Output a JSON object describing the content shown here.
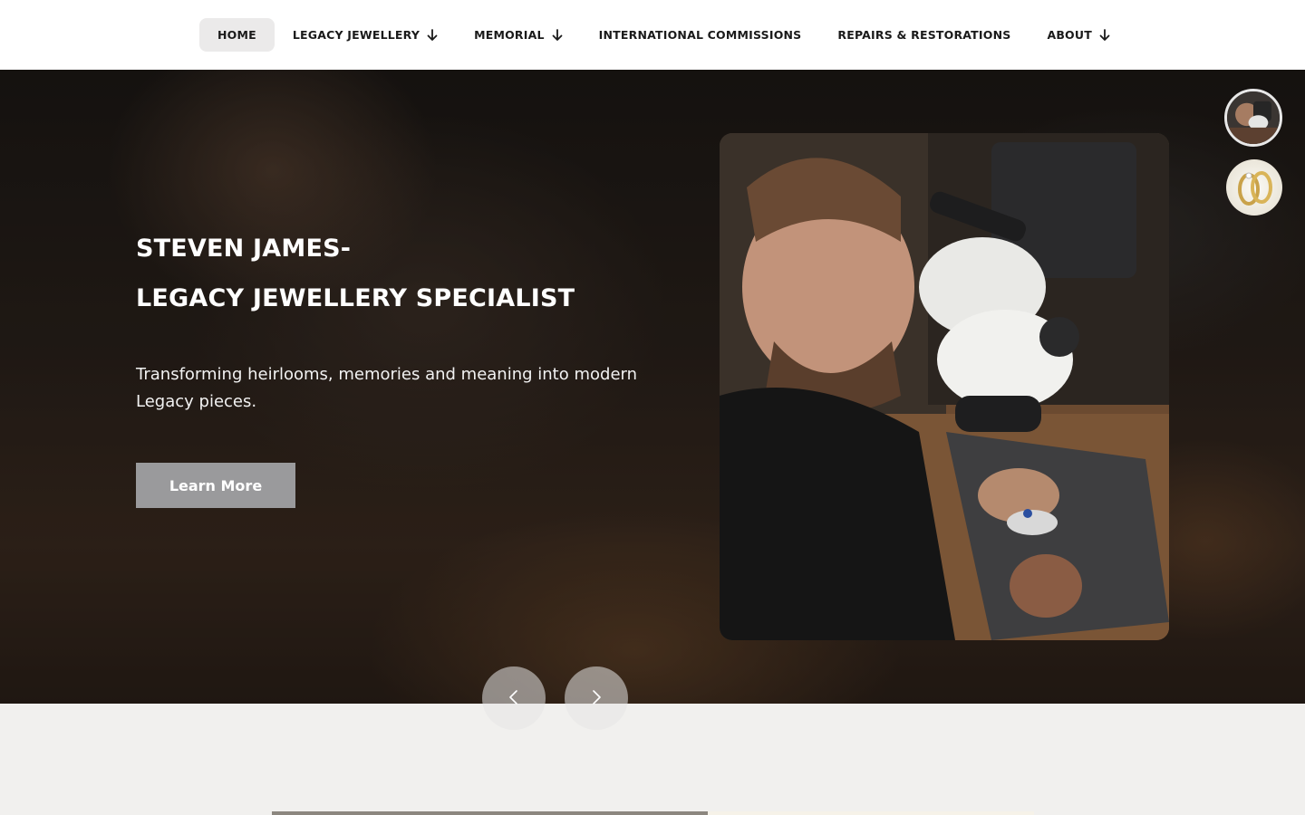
{
  "nav": {
    "items": [
      {
        "label": "HOME",
        "active": true,
        "dropdown": false
      },
      {
        "label": "LEGACY JEWELLERY",
        "active": false,
        "dropdown": true
      },
      {
        "label": "MEMORIAL",
        "active": false,
        "dropdown": true
      },
      {
        "label": "INTERNATIONAL COMMISSIONS",
        "active": false,
        "dropdown": false
      },
      {
        "label": "REPAIRS & RESTORATIONS",
        "active": false,
        "dropdown": false
      },
      {
        "label": "ABOUT",
        "active": false,
        "dropdown": true
      }
    ]
  },
  "hero": {
    "title_line1": "STEVEN JAMES-",
    "title_line2": "LEGACY JEWELLERY SPECIALIST",
    "subtitle": "Transforming heirlooms, memories and meaning into modern Legacy pieces.",
    "cta_label": "Learn More"
  },
  "icons": {
    "dropdown": "arrow-down-icon",
    "prev": "chevron-left-icon",
    "next": "chevron-right-icon"
  },
  "colors": {
    "nav_bg": "#ffffff",
    "nav_active_bg": "#ebeaea",
    "cta_bg": "#9a9a9c",
    "page_bg": "#f1f0ee"
  }
}
